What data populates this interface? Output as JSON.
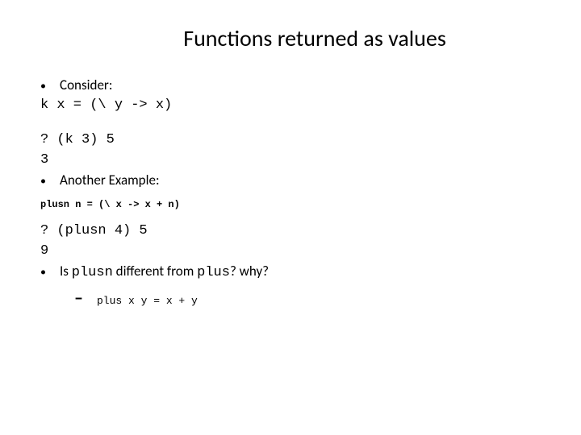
{
  "title": "Functions returned as values",
  "bullet1": "Consider:",
  "code1": "k x = (\\ y -> x)",
  "code2": "? (k 3) 5",
  "code2_result": "3",
  "bullet2": "Another Example:",
  "small_code": "plusn n = (\\ x -> x + n)",
  "code3": "? (plusn 4) 5",
  "code3_result": "9",
  "bullet3_prefix": "Is ",
  "bullet3_code1": "plusn",
  "bullet3_mid": " different from ",
  "bullet3_code2": "plus",
  "bullet3_suffix": "? why?",
  "sub_code": "plus x y = x + y"
}
